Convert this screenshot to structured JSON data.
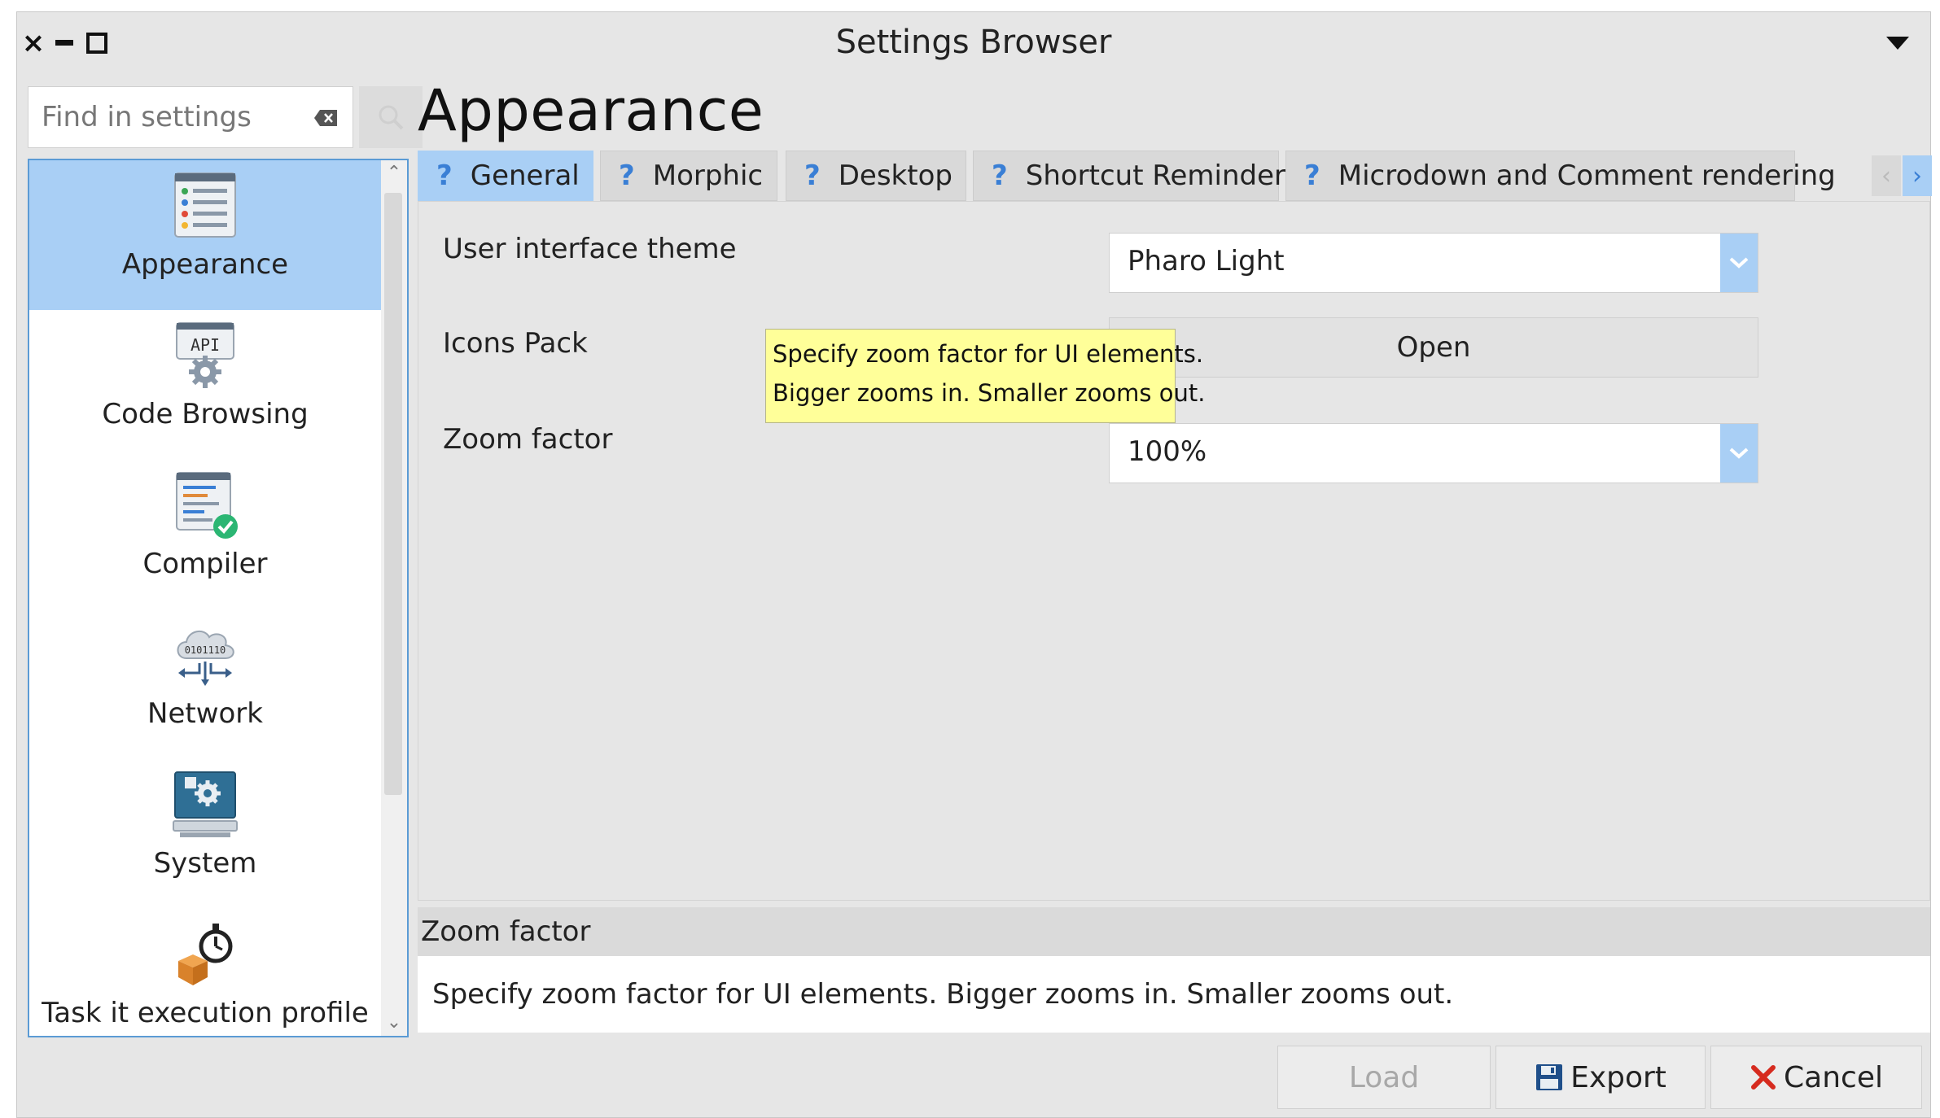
{
  "window": {
    "title": "Settings Browser",
    "controls": [
      "close",
      "minimize",
      "maximize"
    ]
  },
  "search": {
    "placeholder": "Find in settings"
  },
  "sidebar": {
    "items": [
      {
        "label": "Appearance",
        "icon": "appearance-icon",
        "selected": true
      },
      {
        "label": "Code Browsing",
        "icon": "api-gear-icon",
        "selected": false
      },
      {
        "label": "Compiler",
        "icon": "compiler-check-icon",
        "selected": false
      },
      {
        "label": "Network",
        "icon": "network-cloud-icon",
        "selected": false
      },
      {
        "label": "System",
        "icon": "system-monitor-icon",
        "selected": false
      },
      {
        "label": "Task it execution profile",
        "icon": "stopwatch-box-icon",
        "selected": false
      }
    ]
  },
  "page": {
    "title": "Appearance"
  },
  "tabs": [
    {
      "label": "General",
      "active": true
    },
    {
      "label": "Morphic",
      "active": false
    },
    {
      "label": "Desktop",
      "active": false
    },
    {
      "label": "Shortcut Reminder",
      "active": false
    },
    {
      "label": "Microdown and Comment rendering",
      "active": false
    }
  ],
  "settings": {
    "theme": {
      "label": "User interface theme",
      "value": "Pharo Light"
    },
    "icons": {
      "label": "Icons Pack",
      "button": "Open"
    },
    "zoom": {
      "label": "Zoom factor",
      "value": "100%"
    }
  },
  "tooltip": {
    "line1": "Specify zoom factor for UI elements.",
    "line2": "Bigger zooms in. Smaller zooms out."
  },
  "description": {
    "title": "Zoom factor",
    "body": "Specify zoom factor for UI elements. Bigger zooms in. Smaller zooms out."
  },
  "buttons": {
    "load": "Load",
    "export": "Export",
    "cancel": "Cancel"
  },
  "colors": {
    "selection": "#a9cff5",
    "accent": "#3a7fd5",
    "tooltip_bg": "#ffff99",
    "cancel_red": "#d62b1f"
  }
}
